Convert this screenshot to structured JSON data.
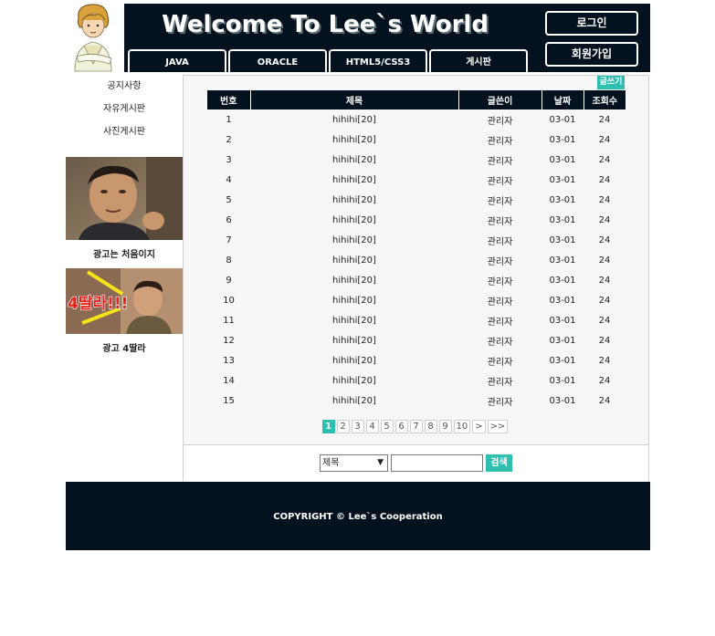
{
  "header": {
    "title": "Welcome To Lee`s World",
    "nav": [
      {
        "label": "JAVA"
      },
      {
        "label": "ORACLE"
      },
      {
        "label": "HTML5/CSS3"
      },
      {
        "label": "게시판"
      }
    ],
    "login_label": "로그인",
    "join_label": "회원가입"
  },
  "sidebar": {
    "links": [
      {
        "label": "공지사항"
      },
      {
        "label": "자유게시판"
      },
      {
        "label": "사진게시판"
      }
    ],
    "ads": [
      {
        "caption": "광고는 처음이지"
      },
      {
        "caption": "광고 4딸라",
        "overlay_text": "4딸라!!!"
      }
    ]
  },
  "board": {
    "write_label": "글쓰기",
    "columns": [
      "번호",
      "제목",
      "글쓴이",
      "날짜",
      "조회수"
    ],
    "rows": [
      {
        "no": "1",
        "title": "hihihi[20]",
        "writer": "관리자",
        "date": "03-01",
        "views": "24"
      },
      {
        "no": "2",
        "title": "hihihi[20]",
        "writer": "관리자",
        "date": "03-01",
        "views": "24"
      },
      {
        "no": "3",
        "title": "hihihi[20]",
        "writer": "관리자",
        "date": "03-01",
        "views": "24"
      },
      {
        "no": "4",
        "title": "hihihi[20]",
        "writer": "관리자",
        "date": "03-01",
        "views": "24"
      },
      {
        "no": "5",
        "title": "hihihi[20]",
        "writer": "관리자",
        "date": "03-01",
        "views": "24"
      },
      {
        "no": "6",
        "title": "hihihi[20]",
        "writer": "관리자",
        "date": "03-01",
        "views": "24"
      },
      {
        "no": "7",
        "title": "hihihi[20]",
        "writer": "관리자",
        "date": "03-01",
        "views": "24"
      },
      {
        "no": "8",
        "title": "hihihi[20]",
        "writer": "관리자",
        "date": "03-01",
        "views": "24"
      },
      {
        "no": "9",
        "title": "hihihi[20]",
        "writer": "관리자",
        "date": "03-01",
        "views": "24"
      },
      {
        "no": "10",
        "title": "hihihi[20]",
        "writer": "관리자",
        "date": "03-01",
        "views": "24"
      },
      {
        "no": "11",
        "title": "hihihi[20]",
        "writer": "관리자",
        "date": "03-01",
        "views": "24"
      },
      {
        "no": "12",
        "title": "hihihi[20]",
        "writer": "관리자",
        "date": "03-01",
        "views": "24"
      },
      {
        "no": "13",
        "title": "hihihi[20]",
        "writer": "관리자",
        "date": "03-01",
        "views": "24"
      },
      {
        "no": "14",
        "title": "hihihi[20]",
        "writer": "관리자",
        "date": "03-01",
        "views": "24"
      },
      {
        "no": "15",
        "title": "hihihi[20]",
        "writer": "관리자",
        "date": "03-01",
        "views": "24"
      }
    ],
    "pages": [
      "1",
      "2",
      "3",
      "4",
      "5",
      "6",
      "7",
      "8",
      "9",
      "10",
      ">",
      ">>"
    ],
    "active_page": "1"
  },
  "search": {
    "field_selected": "제목",
    "query": "",
    "button_label": "검색"
  },
  "footer": {
    "copyright": "COPYRIGHT © Lee`s Cooperation"
  },
  "colors": {
    "navy": "#04111f",
    "accent": "#2fbfb0"
  }
}
